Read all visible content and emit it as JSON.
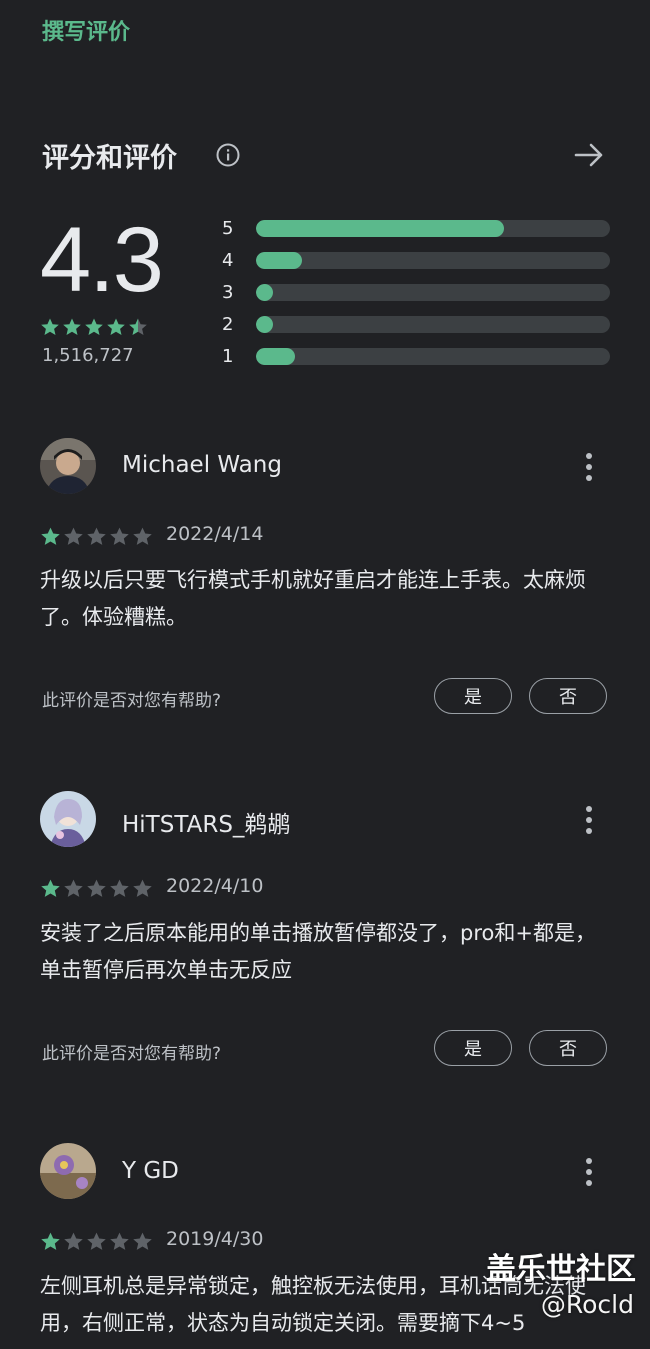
{
  "header": {
    "write_review": "撰写评价"
  },
  "ratings": {
    "title": "评分和评价",
    "score": "4.3",
    "count": "1,516,727",
    "stars_value": 4.5,
    "distribution": [
      {
        "label": "5",
        "fraction": 0.7
      },
      {
        "label": "4",
        "fraction": 0.13
      },
      {
        "label": "3",
        "fraction": 0.04
      },
      {
        "label": "2",
        "fraction": 0.04
      },
      {
        "label": "1",
        "fraction": 0.11
      }
    ]
  },
  "reviews": [
    {
      "name": "Michael Wang",
      "rating": 1,
      "date": "2022/4/14",
      "text": "升级以后只要飞行模式手机就好重启才能连上手表。太麻烦了。体验糟糕。",
      "helpful_question": "此评价是否对您有帮助?",
      "yes": "是",
      "no": "否"
    },
    {
      "name": "HiTSTARS_鹈鹕",
      "rating": 1,
      "date": "2022/4/10",
      "text": "安装了之后原本能用的单击播放暂停都没了，pro和+都是，单击暂停后再次单击无反应",
      "helpful_question": "此评价是否对您有帮助?",
      "yes": "是",
      "no": "否"
    },
    {
      "name": "Y GD",
      "rating": 1,
      "date": "2019/4/30",
      "text": "左侧耳机总是异常锁定，触控板无法使用，耳机话筒无法使用，右侧正常，状态为自动锁定关闭。需要摘下4~5"
    }
  ],
  "watermark": {
    "line1": "盖乐世社区",
    "line2": "@Rocld"
  },
  "colors": {
    "accent": "#5bb98c",
    "background": "#202124",
    "track": "#3c4043",
    "star_empty": "#5f6368"
  },
  "icons": {
    "info": "info-icon",
    "arrow": "arrow-right-icon",
    "more": "more-vert-icon",
    "star": "star-icon"
  }
}
